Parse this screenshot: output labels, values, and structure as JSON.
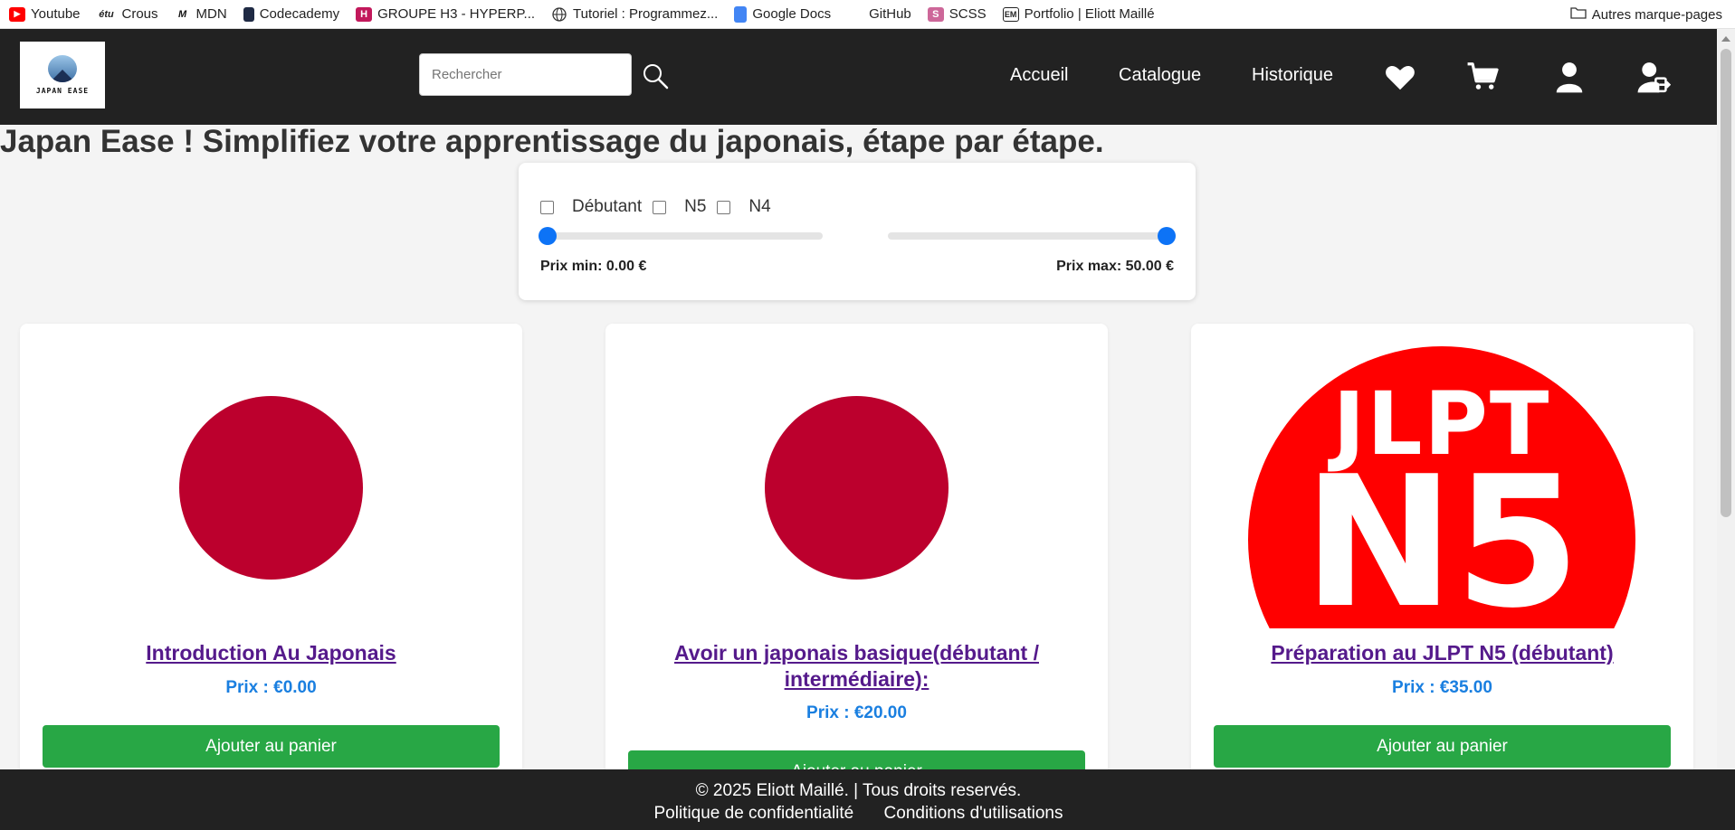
{
  "bookmarks": {
    "items": [
      {
        "label": "Youtube",
        "icon": "youtube-icon"
      },
      {
        "label": "Crous",
        "icon": "etu-icon"
      },
      {
        "label": "MDN",
        "icon": "mdn-icon"
      },
      {
        "label": "Codecademy",
        "icon": "codecademy-icon"
      },
      {
        "label": "GROUPE H3 - HYPERP...",
        "icon": "h-icon"
      },
      {
        "label": "Tutoriel : Programmez...",
        "icon": "globe-icon"
      },
      {
        "label": "Google Docs",
        "icon": "docs-icon"
      },
      {
        "label": "GitHub",
        "icon": "github-icon"
      },
      {
        "label": "SCSS",
        "icon": "sass-icon"
      },
      {
        "label": "Portfolio | Eliott Maillé",
        "icon": "em-icon"
      }
    ],
    "other": "Autres marque-pages"
  },
  "header": {
    "logo_text": "JAPAN EASE",
    "search_placeholder": "Rechercher",
    "nav": [
      "Accueil",
      "Catalogue",
      "Historique"
    ]
  },
  "main": {
    "title": "Japan Ease ! Simplifiez votre apprentissage du japonais, étape par étape."
  },
  "filters": {
    "levels": [
      "Débutant",
      "N5",
      "N4"
    ],
    "price_min_label": "Prix min: 0.00 €",
    "price_max_label": "Prix max: 50.00 €",
    "price_min": 0,
    "price_max": 50
  },
  "cards": [
    {
      "title": "Introduction Au Japonais",
      "price": "Prix : €0.00",
      "button": "Ajouter au panier",
      "image": "japan-flag"
    },
    {
      "title": "Avoir un japonais basique(débutant / intermédiaire):",
      "price": "Prix : €20.00",
      "button": "Ajouter au panier",
      "image": "japan-flag"
    },
    {
      "title": "Préparation au JLPT N5 (débutant)",
      "price": "Prix : €35.00",
      "button": "Ajouter au panier",
      "image": "jlpt-n5",
      "image_text_1": "JLPT",
      "image_text_2": "N5"
    }
  ],
  "footer": {
    "copyright": "© 2025 Eliott Maillé. | Tous droits reservés.",
    "privacy": "Politique de confidentialité",
    "terms": "Conditions d'utilisations"
  },
  "colors": {
    "header_bg": "#222222",
    "accent_blue": "#0d73f6",
    "button_green": "#28a745",
    "link_purple": "#551a8b",
    "price_blue": "#1a7fe0",
    "flag_red": "#bc002d"
  }
}
